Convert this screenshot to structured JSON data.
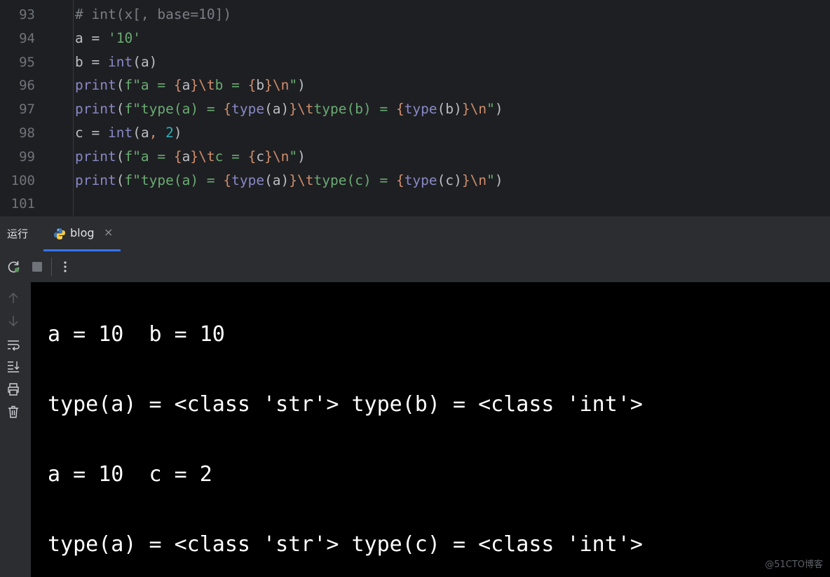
{
  "editor": {
    "line_numbers": [
      "93",
      "94",
      "95",
      "96",
      "97",
      "98",
      "99",
      "100",
      "101"
    ],
    "lines": [
      [
        {
          "t": "# int(x[, base=10])",
          "k": "c"
        }
      ],
      [
        {
          "t": "a = ",
          "k": "ident"
        },
        {
          "t": "'10'",
          "k": "str"
        }
      ],
      [
        {
          "t": "b = ",
          "k": "ident"
        },
        {
          "t": "int",
          "k": "blt"
        },
        {
          "t": "(a)",
          "k": "ident"
        }
      ],
      [
        {
          "t": "print",
          "k": "blt"
        },
        {
          "t": "(",
          "k": "ident"
        },
        {
          "t": "f\"a = ",
          "k": "str"
        },
        {
          "t": "{",
          "k": "brace"
        },
        {
          "t": "a",
          "k": "ident"
        },
        {
          "t": "}",
          "k": "brace"
        },
        {
          "t": "\\t",
          "k": "esc"
        },
        {
          "t": "b = ",
          "k": "str"
        },
        {
          "t": "{",
          "k": "brace"
        },
        {
          "t": "b",
          "k": "ident"
        },
        {
          "t": "}",
          "k": "brace"
        },
        {
          "t": "\\n",
          "k": "esc"
        },
        {
          "t": "\"",
          "k": "str"
        },
        {
          "t": ")",
          "k": "ident"
        }
      ],
      [
        {
          "t": "print",
          "k": "blt"
        },
        {
          "t": "(",
          "k": "ident"
        },
        {
          "t": "f\"type(a) = ",
          "k": "str"
        },
        {
          "t": "{",
          "k": "brace"
        },
        {
          "t": "type",
          "k": "blt"
        },
        {
          "t": "(a)",
          "k": "ident"
        },
        {
          "t": "}",
          "k": "brace"
        },
        {
          "t": "\\t",
          "k": "esc"
        },
        {
          "t": "type(b) = ",
          "k": "str"
        },
        {
          "t": "{",
          "k": "brace"
        },
        {
          "t": "type",
          "k": "blt"
        },
        {
          "t": "(b)",
          "k": "ident"
        },
        {
          "t": "}",
          "k": "brace"
        },
        {
          "t": "\\n",
          "k": "esc"
        },
        {
          "t": "\"",
          "k": "str"
        },
        {
          "t": ")",
          "k": "ident"
        }
      ],
      [
        {
          "t": "c = ",
          "k": "ident"
        },
        {
          "t": "int",
          "k": "blt"
        },
        {
          "t": "(a",
          "k": "ident"
        },
        {
          "t": ", ",
          "k": "brace"
        },
        {
          "t": "2",
          "k": "num"
        },
        {
          "t": ")",
          "k": "ident"
        }
      ],
      [
        {
          "t": "print",
          "k": "blt"
        },
        {
          "t": "(",
          "k": "ident"
        },
        {
          "t": "f\"a = ",
          "k": "str"
        },
        {
          "t": "{",
          "k": "brace"
        },
        {
          "t": "a",
          "k": "ident"
        },
        {
          "t": "}",
          "k": "brace"
        },
        {
          "t": "\\t",
          "k": "esc"
        },
        {
          "t": "c = ",
          "k": "str"
        },
        {
          "t": "{",
          "k": "brace"
        },
        {
          "t": "c",
          "k": "ident"
        },
        {
          "t": "}",
          "k": "brace"
        },
        {
          "t": "\\n",
          "k": "esc"
        },
        {
          "t": "\"",
          "k": "str"
        },
        {
          "t": ")",
          "k": "ident"
        }
      ],
      [
        {
          "t": "print",
          "k": "blt"
        },
        {
          "t": "(",
          "k": "ident"
        },
        {
          "t": "f\"type(a) = ",
          "k": "str"
        },
        {
          "t": "{",
          "k": "brace"
        },
        {
          "t": "type",
          "k": "blt"
        },
        {
          "t": "(a)",
          "k": "ident"
        },
        {
          "t": "}",
          "k": "brace"
        },
        {
          "t": "\\t",
          "k": "esc"
        },
        {
          "t": "type(c) = ",
          "k": "str"
        },
        {
          "t": "{",
          "k": "brace"
        },
        {
          "t": "type",
          "k": "blt"
        },
        {
          "t": "(c)",
          "k": "ident"
        },
        {
          "t": "}",
          "k": "brace"
        },
        {
          "t": "\\n",
          "k": "esc"
        },
        {
          "t": "\"",
          "k": "str"
        },
        {
          "t": ")",
          "k": "ident"
        }
      ],
      []
    ]
  },
  "run_panel": {
    "title": "运行",
    "tab_label": "blog",
    "tab_close": "×"
  },
  "toolbar": {
    "icons": [
      "rerun-icon",
      "stop-icon",
      "more-options-icon"
    ]
  },
  "console_sidebar": {
    "icons": [
      "scroll-up-icon",
      "scroll-down-icon",
      "soft-wrap-icon",
      "scroll-to-end-icon",
      "print-icon",
      "clear-all-icon"
    ]
  },
  "console": {
    "lines": [
      "a = 10  b = 10",
      "type(a) = <class 'str'> type(b) = <class 'int'>",
      "a = 10  c = 2",
      "type(a) = <class 'str'> type(c) = <class 'int'>"
    ]
  },
  "watermark": "@51CTO博客",
  "colors": {
    "editor_bg": "#1e1f22",
    "panel_bg": "#2b2d30",
    "console_bg": "#000000",
    "accent": "#3574f0",
    "string": "#6aab73",
    "builtin": "#8888c6",
    "number": "#2aacb8",
    "brace": "#cf8e6d"
  }
}
